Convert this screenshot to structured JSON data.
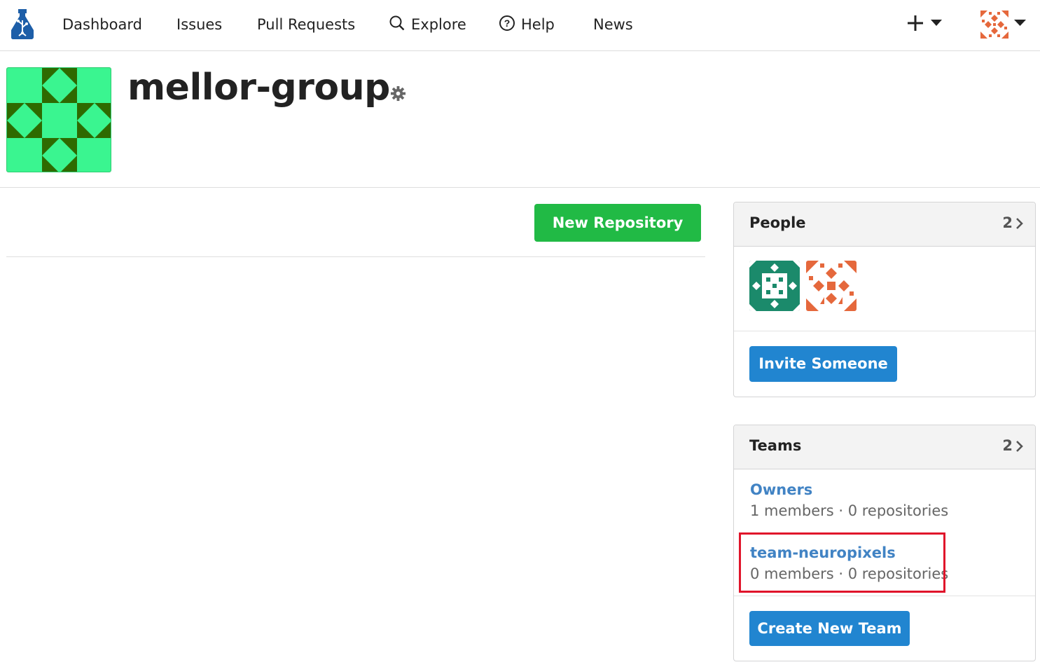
{
  "nav": {
    "items": [
      "Dashboard",
      "Issues",
      "Pull Requests",
      "Explore",
      "Help",
      "News"
    ],
    "plus_label": "+"
  },
  "org": {
    "name": "mellor-group"
  },
  "main": {
    "new_repo_label": "New Repository"
  },
  "people": {
    "title": "People",
    "count": "2",
    "invite_label": "Invite Someone"
  },
  "teams": {
    "title": "Teams",
    "count": "2",
    "items": [
      {
        "name": "Owners",
        "meta": "1 members · 0 repositories"
      },
      {
        "name": "team-neuropixels",
        "meta": "0 members · 0 repositories"
      }
    ],
    "create_label": "Create New Team"
  },
  "colors": {
    "green_button": "#21ba45",
    "blue_button": "#2185d0",
    "link": "#4183c4",
    "highlight": "#e0142a"
  }
}
